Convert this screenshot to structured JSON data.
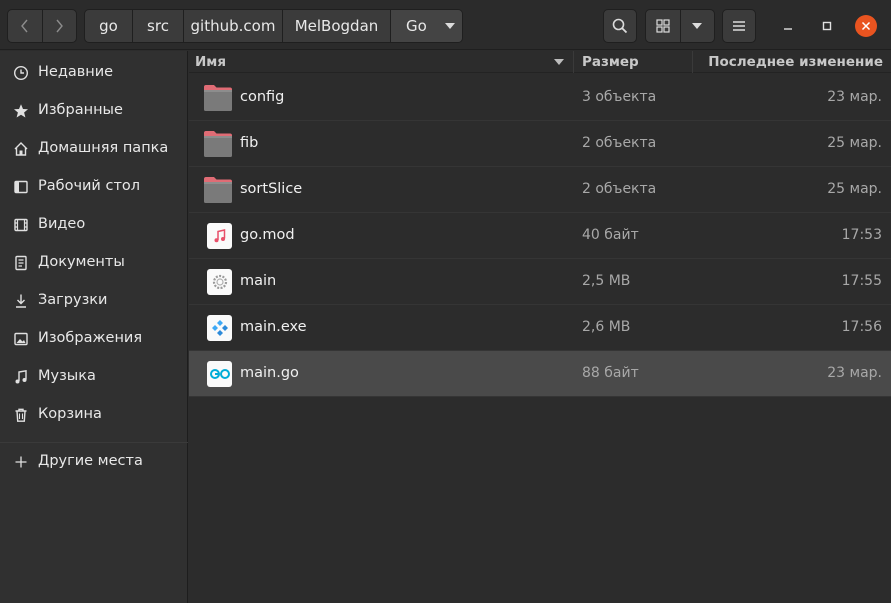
{
  "header": {
    "breadcrumb": [
      "go",
      "src",
      "github.com",
      "MelBogdan",
      "Go"
    ]
  },
  "sidebar": {
    "items": [
      {
        "label": "Недавние",
        "icon": "clock-icon"
      },
      {
        "label": "Избранные",
        "icon": "star-icon"
      },
      {
        "label": "Домашняя папка",
        "icon": "home-icon"
      },
      {
        "label": "Рабочий стол",
        "icon": "desktop-icon"
      },
      {
        "label": "Видео",
        "icon": "video-icon"
      },
      {
        "label": "Документы",
        "icon": "document-icon"
      },
      {
        "label": "Загрузки",
        "icon": "download-icon"
      },
      {
        "label": "Изображения",
        "icon": "image-icon"
      },
      {
        "label": "Музыка",
        "icon": "music-icon"
      },
      {
        "label": "Корзина",
        "icon": "trash-icon"
      }
    ],
    "other_places": "Другие места"
  },
  "columns": {
    "name": "Имя",
    "size": "Размер",
    "modified": "Последнее изменение"
  },
  "files": [
    {
      "name": "config",
      "size": "3 объекта",
      "modified": "23 мар.",
      "type": "folder"
    },
    {
      "name": "fib",
      "size": "2 объекта",
      "modified": "25 мар.",
      "type": "folder"
    },
    {
      "name": "sortSlice",
      "size": "2 объекта",
      "modified": "25 мар.",
      "type": "folder"
    },
    {
      "name": "go.mod",
      "size": "40 байт",
      "modified": "17:53",
      "type": "audio"
    },
    {
      "name": "main",
      "size": "2,5 MB",
      "modified": "17:55",
      "type": "executable"
    },
    {
      "name": "main.exe",
      "size": "2,6 MB",
      "modified": "17:56",
      "type": "exe"
    },
    {
      "name": "main.go",
      "size": "88 байт",
      "modified": "23 мар.",
      "type": "go",
      "selected": true
    }
  ],
  "colors": {
    "folder": "#7a7a7a",
    "folder_tab": "#e06c75",
    "close_button": "#e95420",
    "selection": "#4a4a4a",
    "go_accent": "#00acd7"
  }
}
